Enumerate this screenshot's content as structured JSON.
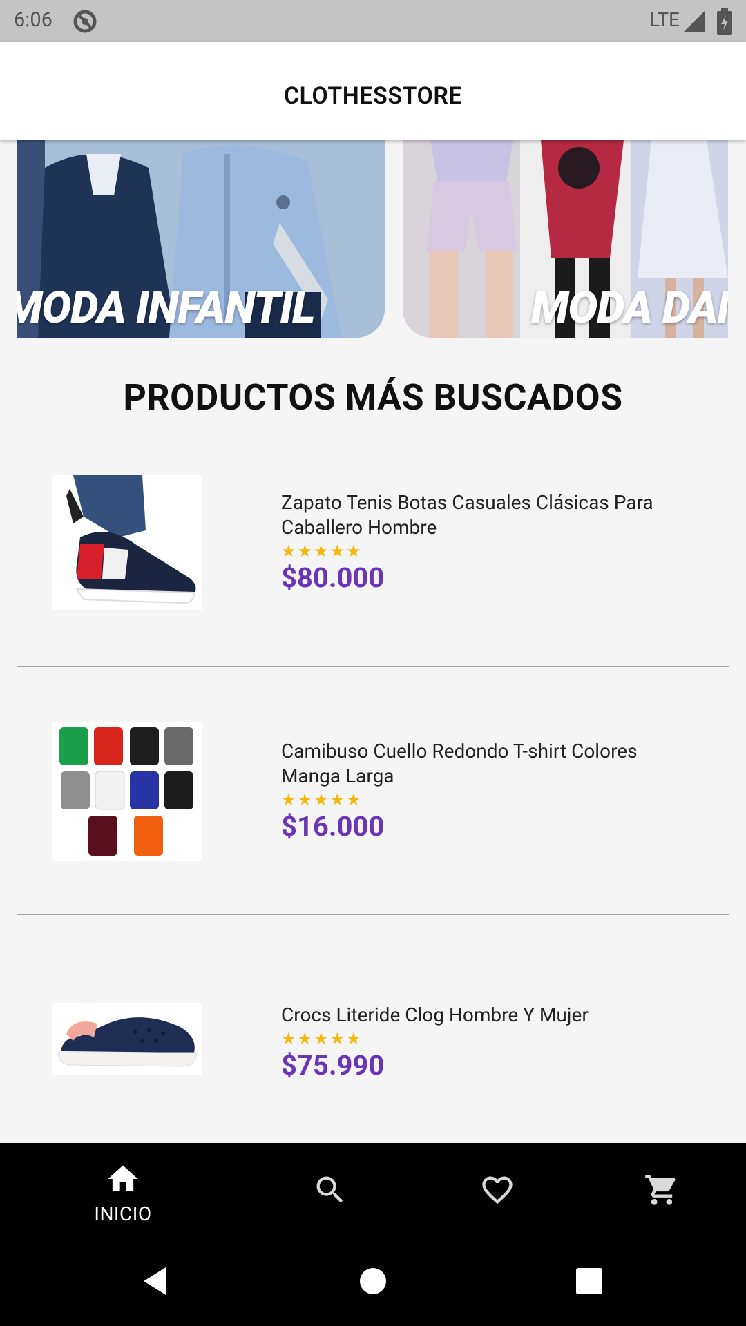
{
  "status_bar": {
    "time": "6:06",
    "network": "LTE"
  },
  "app_bar": {
    "title": "CLOTHESSTORE"
  },
  "banners": [
    {
      "label": "MODA INFANTIL"
    },
    {
      "label": "MODA DAMA"
    }
  ],
  "section": {
    "title": "PRODUCTOS MÁS BUSCADOS"
  },
  "products": [
    {
      "name": "Zapato Tenis Botas Casuales Clásicas Para Caballero Hombre",
      "rating": 5,
      "stars": "★★★★★",
      "price": "$80.000",
      "image": "sneaker-image"
    },
    {
      "name": "Camibuso Cuello Redondo T-shirt Colores Manga Larga",
      "rating": 5,
      "stars": "★★★★★",
      "price": "$16.000",
      "image": "tshirts-image"
    },
    {
      "name": "Crocs Literide Clog Hombre Y Mujer",
      "rating": 5,
      "stars": "★★★★★",
      "price": "$75.990",
      "image": "crocs-image"
    }
  ],
  "bottom_nav": {
    "items": [
      {
        "label": "INICIO",
        "icon": "home-icon",
        "active": true
      },
      {
        "label": "",
        "icon": "search-icon",
        "active": false
      },
      {
        "label": "",
        "icon": "heart-icon",
        "active": false
      },
      {
        "label": "",
        "icon": "cart-icon",
        "active": false
      }
    ]
  },
  "colors": {
    "price": "#6a35b8",
    "stars": "#f5b70a",
    "background": "#f5f5f5",
    "nav_background": "#000000"
  }
}
